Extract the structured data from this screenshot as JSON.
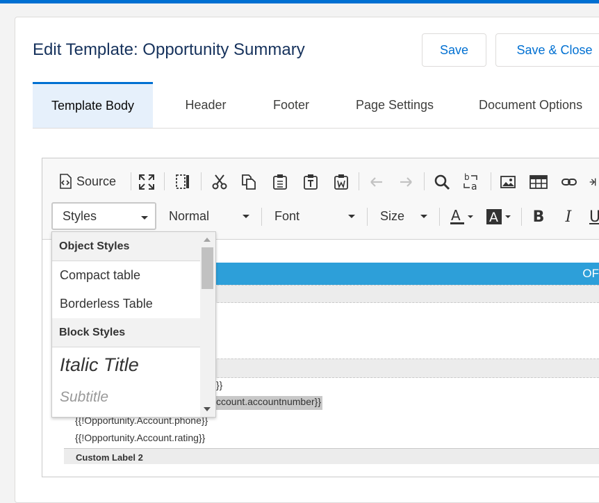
{
  "header": {
    "title": "Edit Template: Opportunity Summary",
    "save_label": "Save",
    "save_close_label": "Save & Close"
  },
  "tabs": [
    {
      "label": "Template Body",
      "active": true
    },
    {
      "label": "Header"
    },
    {
      "label": "Footer"
    },
    {
      "label": "Page Settings"
    },
    {
      "label": "Document Options"
    }
  ],
  "toolbar": {
    "source_label": "Source",
    "styles_label": "Styles",
    "format_label": "Normal",
    "font_label": "Font",
    "size_label": "Size"
  },
  "dropdown": {
    "object_styles_heading": "Object Styles",
    "compact_table": "Compact table",
    "borderless_table": "Borderless Table",
    "block_styles_heading": "Block Styles",
    "italic_title": "Italic Title",
    "subtitle": "Subtitle"
  },
  "document": {
    "band_text": "OF",
    "line_1": "}}",
    "line_2": "ccount.accountnumber}}",
    "line_3": "{{!Opportunity.Account.phone}}",
    "line_4": "{{!Opportunity.Account.rating}}",
    "custom_label": "Custom Label 2"
  },
  "colors": {
    "brand": "#0070d2",
    "title": "#16325c",
    "band": "#2d9fd9"
  }
}
